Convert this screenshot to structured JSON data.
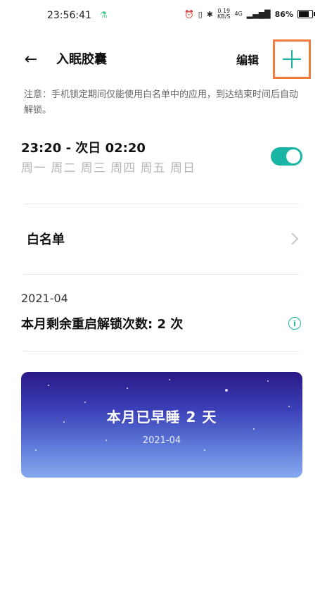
{
  "status_bar": {
    "time": "23:56:41",
    "network_speed": "0.19",
    "network_unit": "KB/S",
    "signal_label": "4G",
    "battery": "86%"
  },
  "header": {
    "title": "入眠胶囊",
    "edit_label": "编辑"
  },
  "notice": "注意：手机锁定期间仅能使用白名单中的应用，到达结束时间后自动解锁。",
  "schedule": {
    "time_range": "23:20 - 次日 02:20",
    "weekdays": "周一 周二 周三 周四 周五 周日",
    "enabled": true
  },
  "whitelist": {
    "label": "白名单"
  },
  "stats": {
    "month": "2021-04",
    "remaining_unlocks": "本月剩余重启解锁次数: 2 次"
  },
  "card": {
    "title": "本月已早睡 2 天",
    "date": "2021-04"
  },
  "colors": {
    "accent": "#1ab5a4",
    "highlight_border": "#f07a3a"
  }
}
